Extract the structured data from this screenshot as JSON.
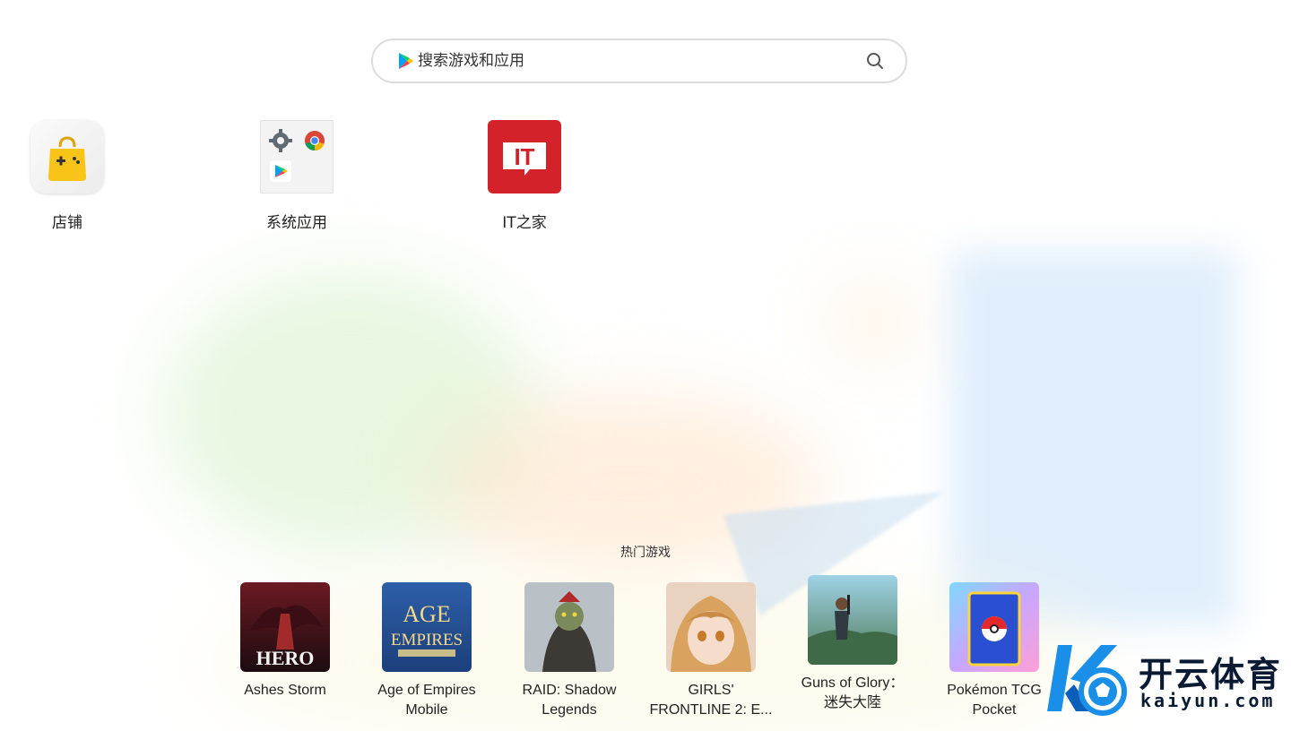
{
  "search": {
    "placeholder": "搜索游戏和应用"
  },
  "apps": [
    {
      "label": "店铺"
    },
    {
      "label": "系统应用"
    },
    {
      "label": "IT之家",
      "icon_text": "IT"
    }
  ],
  "hot_games": {
    "title": "热门游戏",
    "items": [
      {
        "name_line1": "Ashes Storm",
        "name_line2": "",
        "art_text": "HERO"
      },
      {
        "name_line1": "Age of Empires",
        "name_line2": "Mobile",
        "art_text": "AGE EMPIRES"
      },
      {
        "name_line1": "RAID: Shadow",
        "name_line2": "Legends"
      },
      {
        "name_line1": "GIRLS'",
        "name_line2": "FRONTLINE 2: E..."
      },
      {
        "name_line1": "Guns of Glory：",
        "name_line2": "迷失大陸"
      },
      {
        "name_line1": "Pokémon TCG",
        "name_line2": "Pocket"
      }
    ]
  },
  "watermark": {
    "brand": "开云体育",
    "domain": "kaiyun.com"
  },
  "colors": {
    "accent_red": "#d4222a",
    "store_yellow": "#f7c417",
    "brand_blue": "#1a8fe8"
  },
  "icons": [
    "google-play-icon",
    "search-icon",
    "store-bag-icon",
    "settings-gear-icon",
    "chrome-icon",
    "play-store-icon",
    "it-home-icon"
  ]
}
